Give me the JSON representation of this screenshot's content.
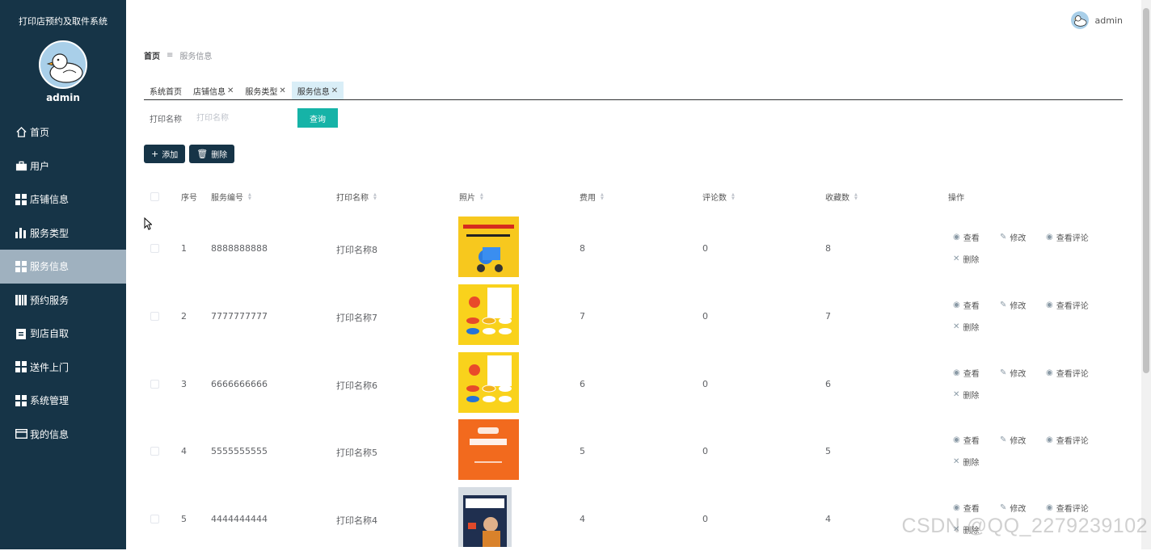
{
  "sidebar": {
    "system_title": "打印店预约及取件系统",
    "username": "admin",
    "items": [
      {
        "label": "首页",
        "icon": "home-icon"
      },
      {
        "label": "用户",
        "icon": "briefcase-icon"
      },
      {
        "label": "店铺信息",
        "icon": "grid-icon"
      },
      {
        "label": "服务类型",
        "icon": "bar-chart-icon"
      },
      {
        "label": "服务信息",
        "icon": "grid-icon",
        "active": true
      },
      {
        "label": "预约服务",
        "icon": "library-icon"
      },
      {
        "label": "到店自取",
        "icon": "clipboard-icon"
      },
      {
        "label": "送件上门",
        "icon": "grid-icon"
      },
      {
        "label": "系统管理",
        "icon": "grid-icon"
      },
      {
        "label": "我的信息",
        "icon": "card-icon"
      }
    ]
  },
  "topbar": {
    "username": "admin"
  },
  "breadcrumb": {
    "home": "首页",
    "current": "服务信息"
  },
  "tabs": [
    {
      "label": "系统首页",
      "closable": false
    },
    {
      "label": "店铺信息",
      "closable": true
    },
    {
      "label": "服务类型",
      "closable": true
    },
    {
      "label": "服务信息",
      "closable": true,
      "active": true
    }
  ],
  "search": {
    "label": "打印名称",
    "placeholder": "打印名称",
    "button": "查询"
  },
  "actions": {
    "add": "添加",
    "delete": "删除"
  },
  "table": {
    "headers": {
      "index": "序号",
      "code": "服务编号",
      "name": "打印名称",
      "photo": "照片",
      "fee": "费用",
      "comments": "评论数",
      "favorites": "收藏数",
      "ops": "操作"
    },
    "op_labels": {
      "view": "查看",
      "edit": "修改",
      "view_comments": "查看评论",
      "delete": "删除"
    },
    "rows": [
      {
        "index": "1",
        "code": "8888888888",
        "name": "打印名称8",
        "fee": "8",
        "comments": "0",
        "favorites": "8",
        "photo_style": "yellow-delivery"
      },
      {
        "index": "2",
        "code": "7777777777",
        "name": "打印名称7",
        "fee": "7",
        "comments": "0",
        "favorites": "7",
        "photo_style": "yellow-poster"
      },
      {
        "index": "3",
        "code": "6666666666",
        "name": "打印名称6",
        "fee": "6",
        "comments": "0",
        "favorites": "6",
        "photo_style": "yellow-poster"
      },
      {
        "index": "4",
        "code": "5555555555",
        "name": "打印名称5",
        "fee": "5",
        "comments": "0",
        "favorites": "5",
        "photo_style": "orange-delivery"
      },
      {
        "index": "5",
        "code": "4444444444",
        "name": "打印名称4",
        "fee": "4",
        "comments": "0",
        "favorites": "4",
        "photo_style": "city-express"
      }
    ]
  },
  "watermark": "CSDN @QQ_2279239102",
  "colors": {
    "sidebar_bg": "#163447",
    "active_menu": "#9fb1bf",
    "search_btn": "#16b3a7",
    "action_btn": "#163447"
  }
}
